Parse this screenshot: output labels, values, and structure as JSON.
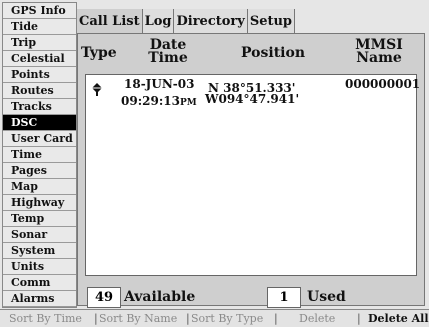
{
  "sidebar": {
    "items": [
      {
        "label": "GPS Info"
      },
      {
        "label": "Tide"
      },
      {
        "label": "Trip"
      },
      {
        "label": "Celestial"
      },
      {
        "label": "Points"
      },
      {
        "label": "Routes"
      },
      {
        "label": "Tracks"
      },
      {
        "label": "DSC"
      },
      {
        "label": "User Card"
      },
      {
        "label": "Time"
      },
      {
        "label": "Pages"
      },
      {
        "label": "Map"
      },
      {
        "label": "Highway"
      },
      {
        "label": "Temp"
      },
      {
        "label": "Sonar"
      },
      {
        "label": "System"
      },
      {
        "label": "Units"
      },
      {
        "label": "Comm"
      },
      {
        "label": "Alarms"
      }
    ],
    "selected": "DSC"
  },
  "tabs": [
    "Call List",
    "Log",
    "Directory",
    "Setup"
  ],
  "columns": {
    "type": "Type",
    "date_line1": "Date",
    "date_line2": "Time",
    "position": "Position",
    "mmsi_line1": "MMSI",
    "mmsi_line2": "Name"
  },
  "log_entries": [
    {
      "type_icon": "distress-call-icon",
      "date": "18-JUN-03",
      "time": "09:29:13",
      "ampm": "PM",
      "lat": "N  38°51.333'",
      "lon": "W094°47.941'",
      "mmsi": "000000001"
    }
  ],
  "status": {
    "available_count": "49",
    "available_label": "Available",
    "used_count": "1",
    "used_label": "Used"
  },
  "softkeys": [
    {
      "label": "Sort By Time",
      "enabled": false
    },
    {
      "label": "Sort By Name",
      "enabled": false
    },
    {
      "label": "Sort By Type",
      "enabled": false
    },
    {
      "label": "Delete",
      "enabled": false
    },
    {
      "label": "Delete All",
      "enabled": true
    }
  ],
  "colors": {
    "background": "#e6e6e6",
    "selected_bg": "#000000",
    "list_bg": "#ffffff",
    "disabled_text": "#8a8a8a"
  }
}
